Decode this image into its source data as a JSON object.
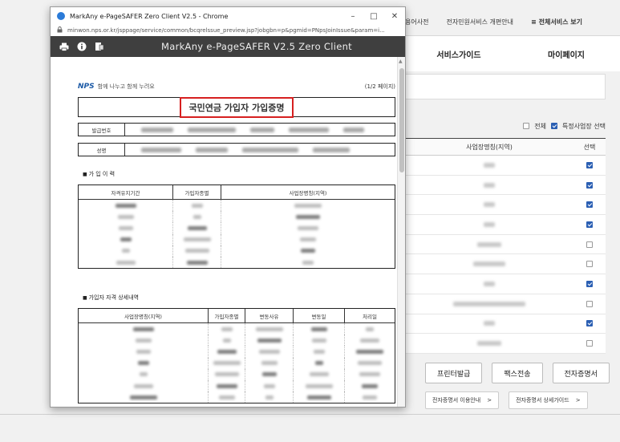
{
  "background": {
    "top_nav": [
      "용어사전",
      "전자민원서비스 개편안내",
      "전체서비스 보기"
    ],
    "top_nav_menu_glyph": "≡",
    "main_nav": [
      "서비스가이드",
      "마이페이지"
    ],
    "checks": {
      "all_label": "전체",
      "all_checked": false,
      "specific_label": "특정사업장 선택",
      "specific_checked": true
    },
    "table": {
      "header_site": "사업장명칭(지역)",
      "header_select": "선택",
      "rows_checked": [
        true,
        true,
        true,
        true,
        false,
        false,
        true,
        false,
        true,
        false
      ]
    },
    "buttons": [
      "프린터발급",
      "팩스전송",
      "전자증명서"
    ],
    "links": [
      {
        "label": "전자증명서 이용안내",
        "arrow": ">"
      },
      {
        "label": "전자증명서 상세가이드",
        "arrow": ">"
      }
    ]
  },
  "popup": {
    "window_title": "MarkAny e-PageSAFER Zero Client V2.5 - Chrome",
    "window_buttons": [
      "–",
      "□",
      "✕"
    ],
    "url": "minwon.nps.or.kr/jsppage/service/common/bcqrelssue_preview.jsp?jobgbn=p&pgmid=PNpsJoinIssue&param=i...",
    "viewer_title": "MarkAny e-PageSAFER V2.5 Zero Client",
    "toolbar_icons": [
      "printer-icon",
      "info-icon",
      "save-icon"
    ],
    "document": {
      "logo": "NPS",
      "slogan": "함께 나누고 함께 누려요",
      "page_indicator": "(1/2 페이지)",
      "title": "국민연금 가입자 가입증명",
      "issue_no_label": "발급번호",
      "name_label": "성명",
      "section1_title": "가 입 이 력",
      "section1_headers": [
        "자격유지기간",
        "가입자종별",
        "사업장명칭(지역)"
      ],
      "section2_title": "가입자 자격 상세내역",
      "section2_headers": [
        "사업장명칭(지역)",
        "가입자종별",
        "변동사유",
        "변동일",
        "처리일"
      ]
    }
  }
}
